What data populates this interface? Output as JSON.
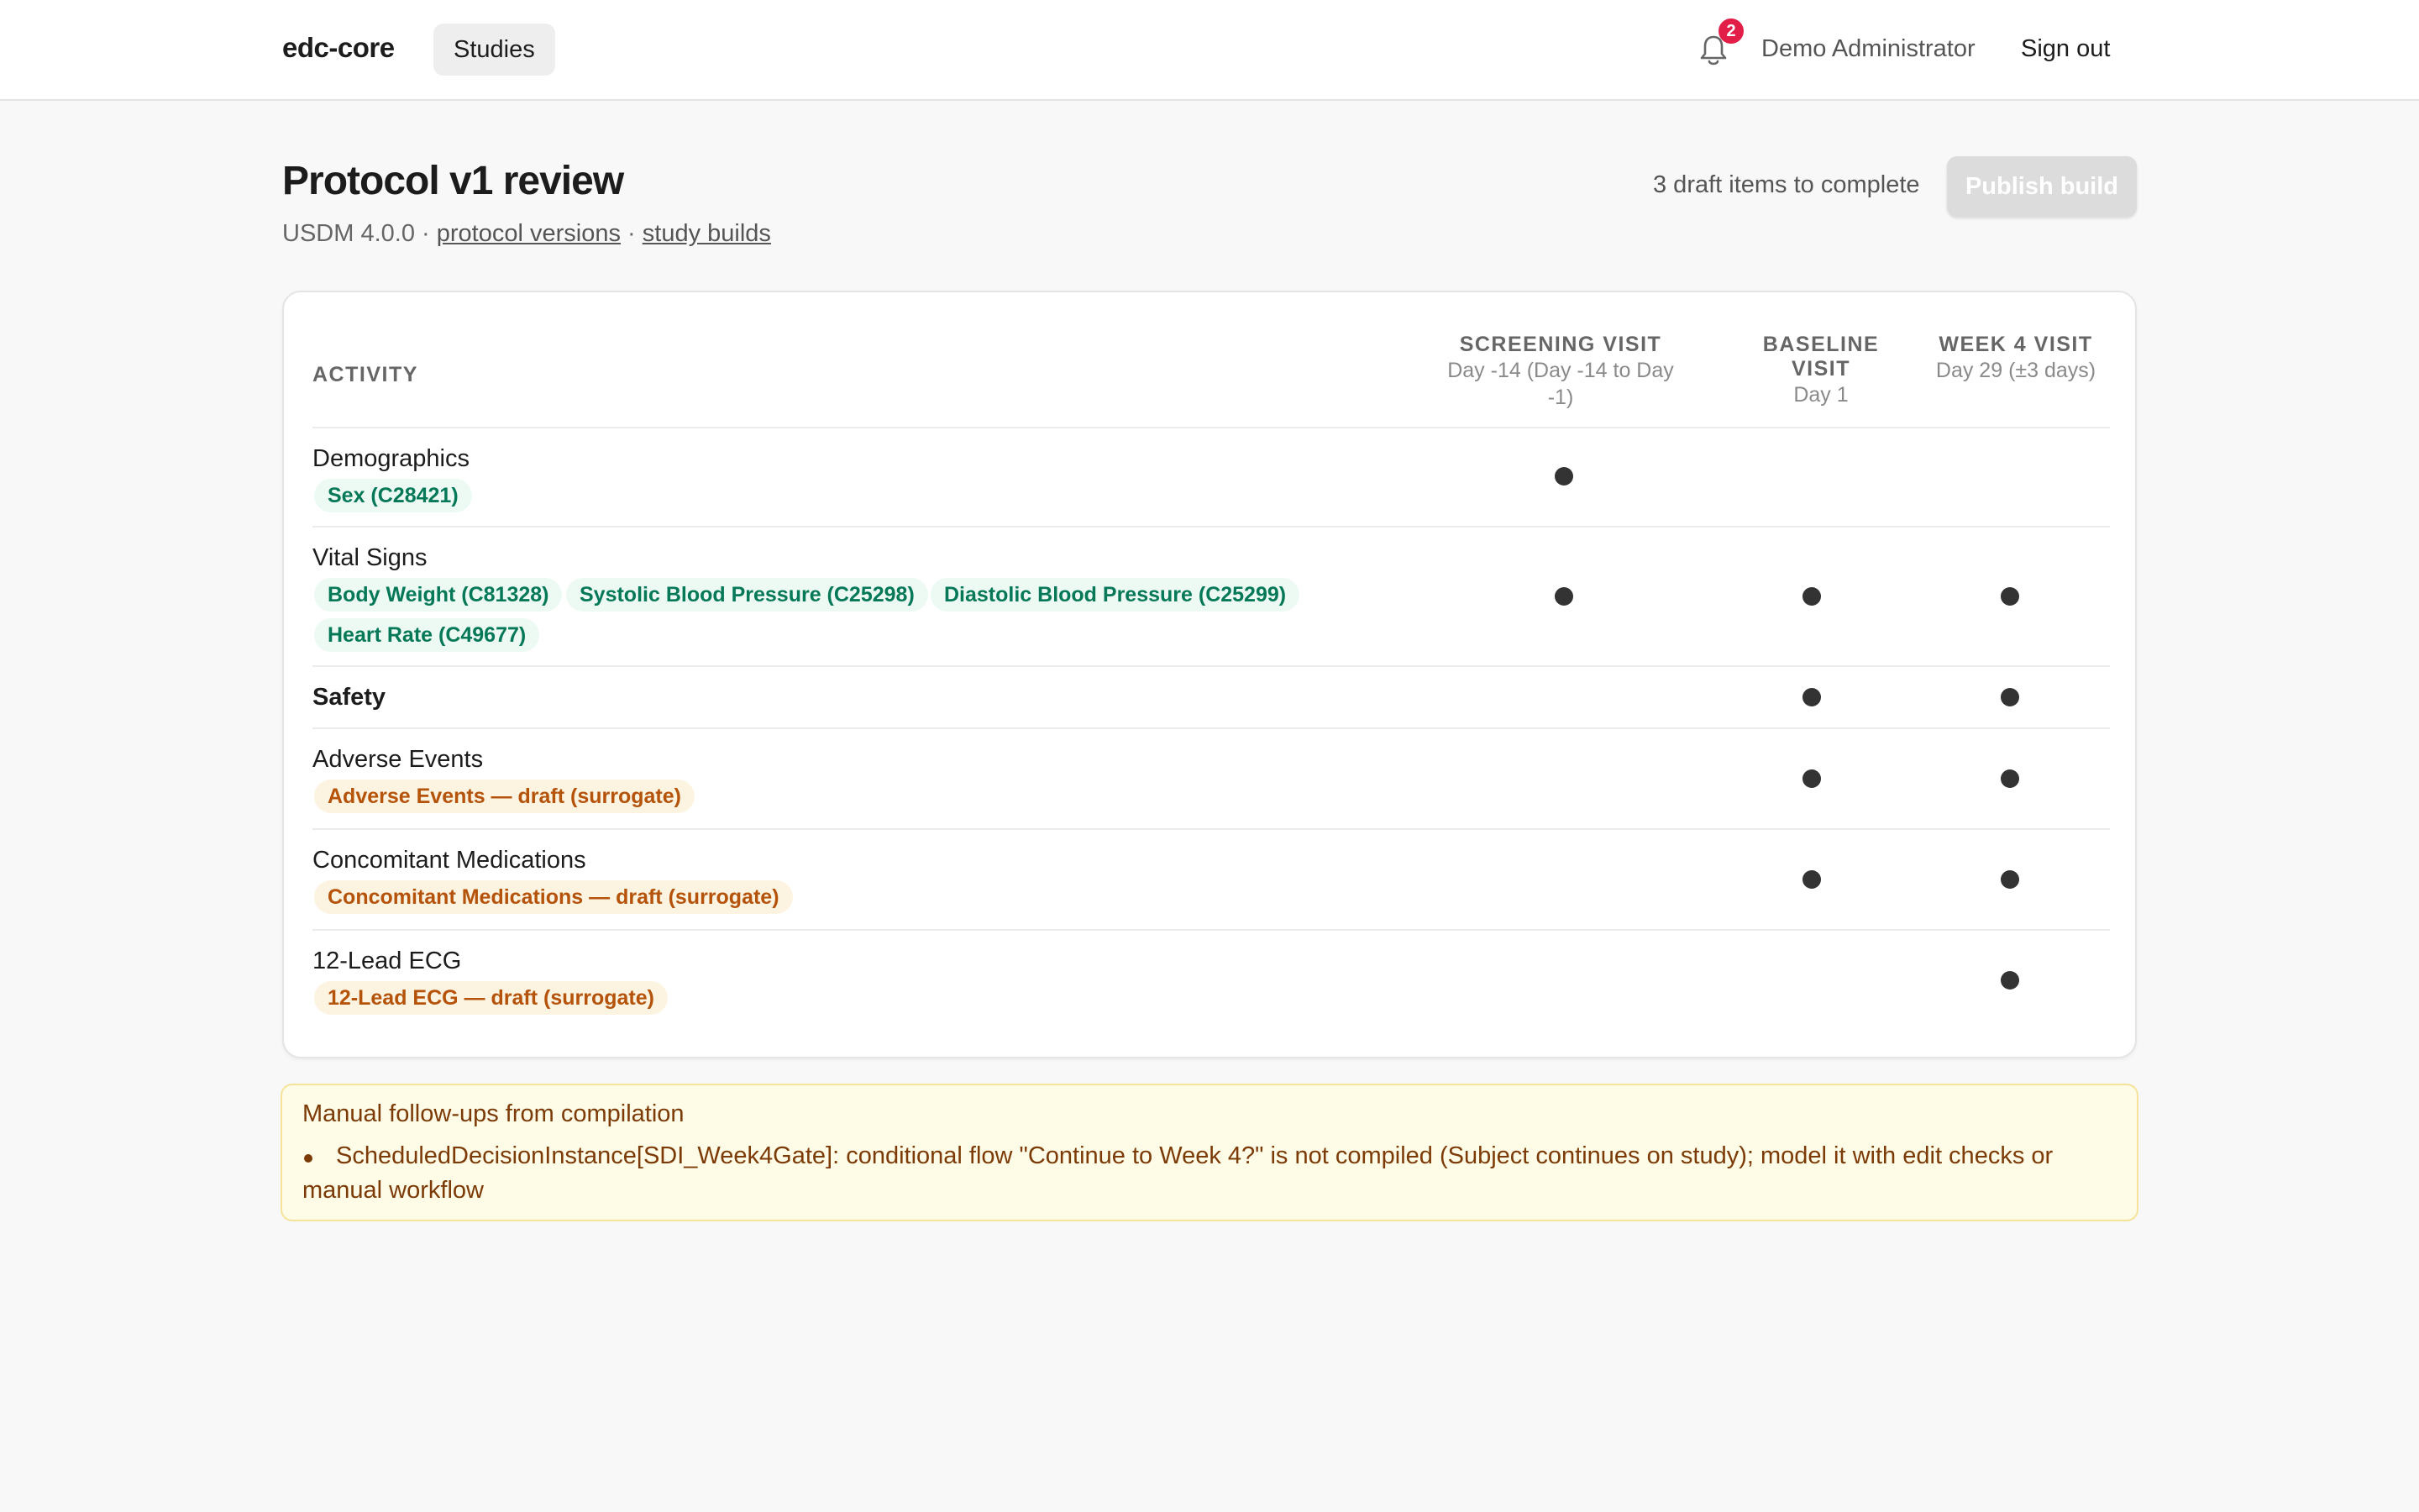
{
  "topbar": {
    "brand": "edc-core",
    "nav_studies": "Studies",
    "notifications_count": "2",
    "user_name": "Demo Administrator",
    "signout_label": "Sign out"
  },
  "header": {
    "title": "Protocol v1 review",
    "usdm": "USDM 4.0.0",
    "sep": "·",
    "link_protocol_versions": "protocol versions",
    "link_study_builds": "study builds",
    "draft_count": "3 draft items to complete",
    "publish_label": "Publish build"
  },
  "table": {
    "activity_header": "ACTIVITY",
    "visits": [
      {
        "name": "SCREENING VISIT",
        "sub": "Day -14 (Day -14 to Day -1)"
      },
      {
        "name": "BASELINE VISIT",
        "sub": "Day 1"
      },
      {
        "name": "WEEK 4 VISIT",
        "sub": "Day 29 (±3 days)"
      }
    ],
    "rows": [
      {
        "label": "Demographics",
        "chips": [
          "Sex (C28421)"
        ],
        "marks": [
          true,
          false,
          false
        ]
      },
      {
        "label": "Vital Signs",
        "chips": [
          "Body Weight (C81328)",
          "Systolic Blood Pressure (C25298)",
          "Diastolic Blood Pressure (C25299)",
          "Heart Rate (C49677)"
        ],
        "marks": [
          true,
          true,
          true
        ]
      },
      {
        "label": "Safety",
        "chips": [],
        "marks": [
          false,
          true,
          true
        ]
      },
      {
        "label": "Adverse Events",
        "chips": [
          "Adverse Events — draft (surrogate)"
        ],
        "marks": [
          false,
          true,
          true
        ]
      },
      {
        "label": "Concomitant Medications",
        "chips": [
          "Concomitant Medications — draft (surrogate)"
        ],
        "marks": [
          false,
          true,
          true
        ]
      },
      {
        "label": "12-Lead ECG",
        "chips": [
          "12-Lead ECG — draft (surrogate)"
        ],
        "marks": [
          false,
          false,
          true
        ]
      }
    ]
  },
  "followups": {
    "title": "Manual follow-ups from compilation",
    "items": [
      "ScheduledDecisionInstance[SDI_Week4Gate]: conditional flow \"Continue to Week 4?\" is not compiled (Subject continues on study); model it with edit checks or manual workflow"
    ]
  },
  "colors": {
    "chip_green_text": "#047857",
    "chip_amber_text": "#b45309",
    "badge": "#e11d48",
    "followup_bg": "#fefbe6"
  }
}
